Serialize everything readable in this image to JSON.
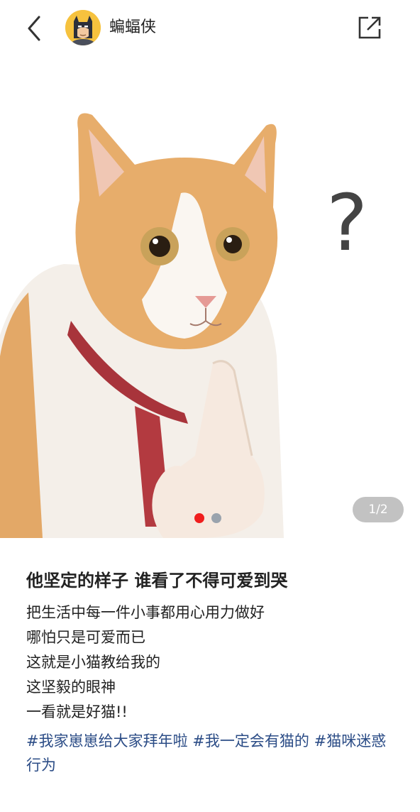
{
  "header": {
    "back_icon": "chevron-left-icon",
    "avatar_icon": "batman-avatar",
    "author_name": "蝙蝠侠",
    "share_icon": "external-link-icon"
  },
  "media": {
    "image_description_icon": "cat-question-image",
    "page_counter": "1/2",
    "dots": [
      {
        "active": true,
        "color": "#f01e1e"
      },
      {
        "active": false,
        "color": "#9aa3ad"
      }
    ]
  },
  "post": {
    "title": "他坚定的样子 谁看了不得可爱到哭",
    "body": [
      "把生活中每一件小事都用心用力做好",
      "哪怕只是可爱而已",
      "这就是小猫教给我的",
      "这坚毅的眼神",
      "一看就是好猫!!"
    ],
    "tags": [
      "#我家崽崽给大家拜年啦",
      "#我一定会有猫的",
      "#猫咪迷惑行为"
    ]
  },
  "colors": {
    "tag": "#2b4c86",
    "active_dot": "#f01e1e",
    "inactive_dot": "#9aa3ad",
    "avatar_bg": "#f6c23e"
  }
}
